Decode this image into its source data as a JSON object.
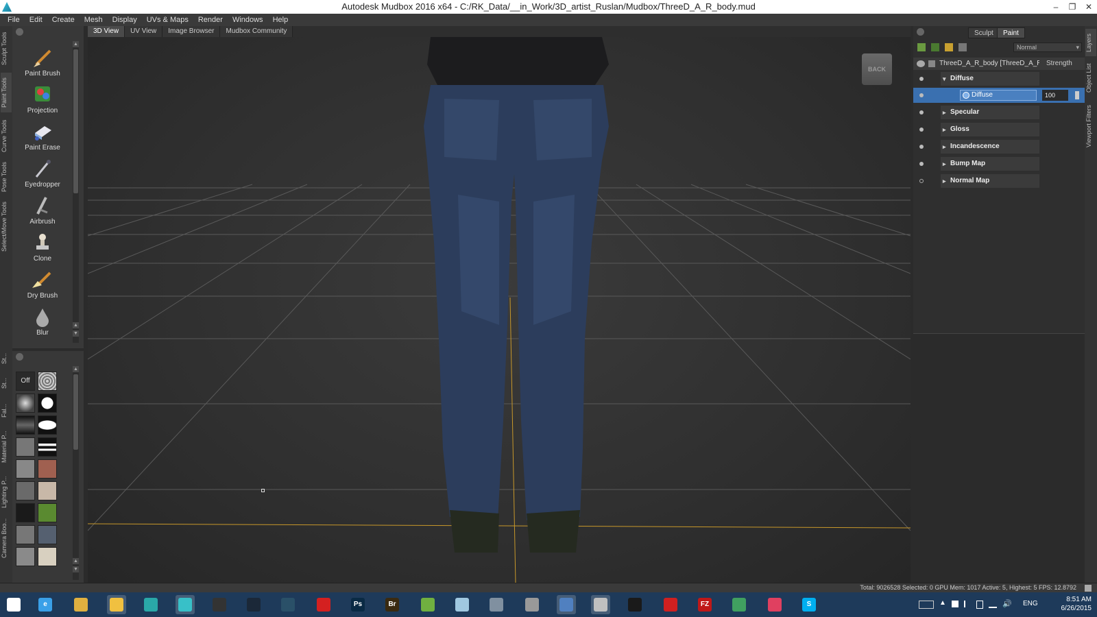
{
  "window": {
    "title": "Autodesk Mudbox 2016 x64 - C:/RK_Data/__in_Work/3D_artist_Ruslan/Mudbox/ThreeD_A_R_body.mud",
    "controls": [
      "–",
      "❐",
      "✕"
    ]
  },
  "menu": [
    "File",
    "Edit",
    "Create",
    "Mesh",
    "Display",
    "UVs & Maps",
    "Render",
    "Windows",
    "Help"
  ],
  "left_tabs": [
    "Sculpt Tools",
    "Paint Tools",
    "Curve Tools",
    "Pose Tools",
    "Select/Move Tools"
  ],
  "lower_left_tabs": [
    "St...",
    "St...",
    "Fal...",
    "Material P...",
    "Lighting P...",
    "Camera Boo..."
  ],
  "tools": [
    {
      "label": "Paint Brush",
      "icon": "paint-brush-icon"
    },
    {
      "label": "Projection",
      "icon": "projection-icon"
    },
    {
      "label": "Paint Erase",
      "icon": "eraser-icon"
    },
    {
      "label": "Eyedropper",
      "icon": "eyedropper-icon"
    },
    {
      "label": "Airbrush",
      "icon": "airbrush-icon"
    },
    {
      "label": "Clone",
      "icon": "clone-stamp-icon"
    },
    {
      "label": "Dry Brush",
      "icon": "dry-brush-icon"
    },
    {
      "label": "Blur",
      "icon": "blur-drop-icon"
    }
  ],
  "stamps": {
    "off_label": "Off"
  },
  "view_tabs": [
    "3D View",
    "UV View",
    "Image Browser",
    "Mudbox Community"
  ],
  "viewcube": {
    "label": "BACK"
  },
  "right_panel": {
    "mode_tabs": [
      "Sculpt",
      "Paint"
    ],
    "blend_mode": "Normal",
    "layer_name": "ThreeD_A_R_body [ThreeD_A_R_",
    "strength_header": "Strength",
    "channels": [
      {
        "label": "Diffuse",
        "expanded": true
      },
      {
        "label": "Specular",
        "expanded": false
      },
      {
        "label": "Gloss",
        "expanded": false
      },
      {
        "label": "Incandescence",
        "expanded": false
      },
      {
        "label": "Bump Map",
        "expanded": false
      },
      {
        "label": "Normal Map",
        "expanded": false
      }
    ],
    "active_layer": {
      "label": "Diffuse",
      "strength": "100"
    }
  },
  "right_tabs": [
    "Layers",
    "Object List",
    "Viewport Filters"
  ],
  "status": "Total: 9026528  Selected: 0 GPU Mem: 1017  Active: 5, Highest: 5  FPS: 12.8792",
  "taskbar": {
    "apps": [
      {
        "name": "start-button",
        "glyph": "⊞",
        "color": "#ffffff"
      },
      {
        "name": "internet-explorer",
        "glyph": "e",
        "color": "#3aa0e8"
      },
      {
        "name": "file-manager",
        "glyph": "",
        "color": "#e0b040"
      },
      {
        "name": "file-explorer",
        "glyph": "",
        "color": "#f0c040"
      },
      {
        "name": "mudbox-lt",
        "glyph": "",
        "color": "#2aa8a8"
      },
      {
        "name": "mudbox",
        "glyph": "",
        "color": "#38c0c8"
      },
      {
        "name": "obs",
        "glyph": "",
        "color": "#333333"
      },
      {
        "name": "steam",
        "glyph": "",
        "color": "#1b2838"
      },
      {
        "name": "blender-sync",
        "glyph": "",
        "color": "#2a5068"
      },
      {
        "name": "creative-cloud",
        "glyph": "",
        "color": "#d42020"
      },
      {
        "name": "photoshop",
        "glyph": "Ps",
        "color": "#0a2a44"
      },
      {
        "name": "bridge",
        "glyph": "Br",
        "color": "#3a2a10"
      },
      {
        "name": "spreadsheet",
        "glyph": "",
        "color": "#70b040"
      },
      {
        "name": "notepad",
        "glyph": "",
        "color": "#a0c8e0"
      },
      {
        "name": "calculator",
        "glyph": "",
        "color": "#8090a0"
      },
      {
        "name": "zbrush",
        "glyph": "",
        "color": "#999999"
      },
      {
        "name": "remote-desktop",
        "glyph": "",
        "color": "#5080c0"
      },
      {
        "name": "image-viewer",
        "glyph": "",
        "color": "#c0c0c0"
      },
      {
        "name": "camera-app",
        "glyph": "",
        "color": "#1a1a1a"
      },
      {
        "name": "substance",
        "glyph": "",
        "color": "#d02020"
      },
      {
        "name": "filezilla",
        "glyph": "FZ",
        "color": "#c01818"
      },
      {
        "name": "globe-app",
        "glyph": "",
        "color": "#40a060"
      },
      {
        "name": "itunes",
        "glyph": "",
        "color": "#e04060"
      },
      {
        "name": "skype",
        "glyph": "S",
        "color": "#00aff0"
      }
    ],
    "language": "ENG",
    "time": "8:51 AM",
    "date": "6/26/2015"
  }
}
